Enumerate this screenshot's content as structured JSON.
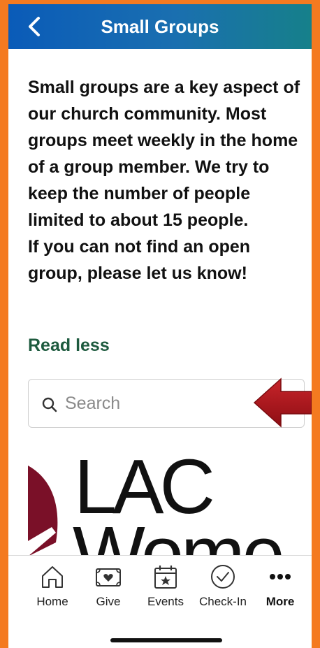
{
  "header": {
    "title": "Small Groups"
  },
  "intro": {
    "paragraph_1": "Small groups are a key aspect of our church community. Most groups meet weekly in the home of a group member. We try to keep the number of people limited to about 15 people.",
    "paragraph_2": "If you can not find an open group, please let us know!",
    "read_less": "Read less"
  },
  "search": {
    "placeholder": "Search"
  },
  "logo": {
    "line_1": "LAC",
    "line_2": "Wome"
  },
  "tabbar": {
    "items": [
      {
        "label": "Home",
        "icon": "home-icon"
      },
      {
        "label": "Give",
        "icon": "give-icon"
      },
      {
        "label": "Events",
        "icon": "events-icon"
      },
      {
        "label": "Check-In",
        "icon": "check-in-icon"
      },
      {
        "label": "More",
        "icon": "more-icon"
      }
    ]
  },
  "colors": {
    "frame": "#f47a20",
    "header_start": "#0a5bb8",
    "header_end": "#16808a",
    "read_less": "#1d5a3e",
    "arrow": "#b0141a",
    "logo_accent": "#7a1028"
  }
}
